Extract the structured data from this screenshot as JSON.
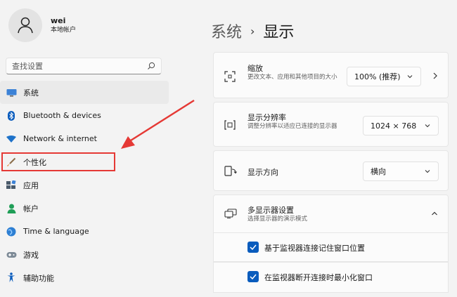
{
  "profile": {
    "name": "wei",
    "account_type": "本地帐户"
  },
  "search": {
    "placeholder": "查找设置"
  },
  "sidebar": {
    "items": [
      {
        "label": "系统",
        "icon": "system-icon"
      },
      {
        "label": "Bluetooth & devices",
        "icon": "bluetooth-icon"
      },
      {
        "label": "Network & internet",
        "icon": "wifi-icon"
      },
      {
        "label": "个性化",
        "icon": "brush-icon"
      },
      {
        "label": "应用",
        "icon": "apps-icon"
      },
      {
        "label": "帐户",
        "icon": "account-icon"
      },
      {
        "label": "Time & language",
        "icon": "globe-icon"
      },
      {
        "label": "游戏",
        "icon": "gamepad-icon"
      },
      {
        "label": "辅助功能",
        "icon": "accessibility-icon"
      }
    ]
  },
  "breadcrumb": {
    "parent": "系统",
    "current": "显示"
  },
  "settings": {
    "scale": {
      "title": "缩放",
      "desc": "更改文本、应用和其他项目的大小",
      "value": "100% (推荐)"
    },
    "resolution": {
      "title": "显示分辨率",
      "desc": "调整分辨率以适应已连接的显示器",
      "value": "1024 × 768"
    },
    "orientation": {
      "title": "显示方向",
      "value": "横向"
    },
    "multi_display": {
      "title": "多显示器设置",
      "desc": "选择显示器的演示模式"
    },
    "remember_windows": {
      "label": "基于监视器连接记住窗口位置",
      "checked": true
    },
    "minimize_windows": {
      "label": "在监视器断开连接时最小化窗口",
      "checked": true
    }
  },
  "colors": {
    "accent": "#0a5cbd",
    "annotation": "#e53935"
  }
}
